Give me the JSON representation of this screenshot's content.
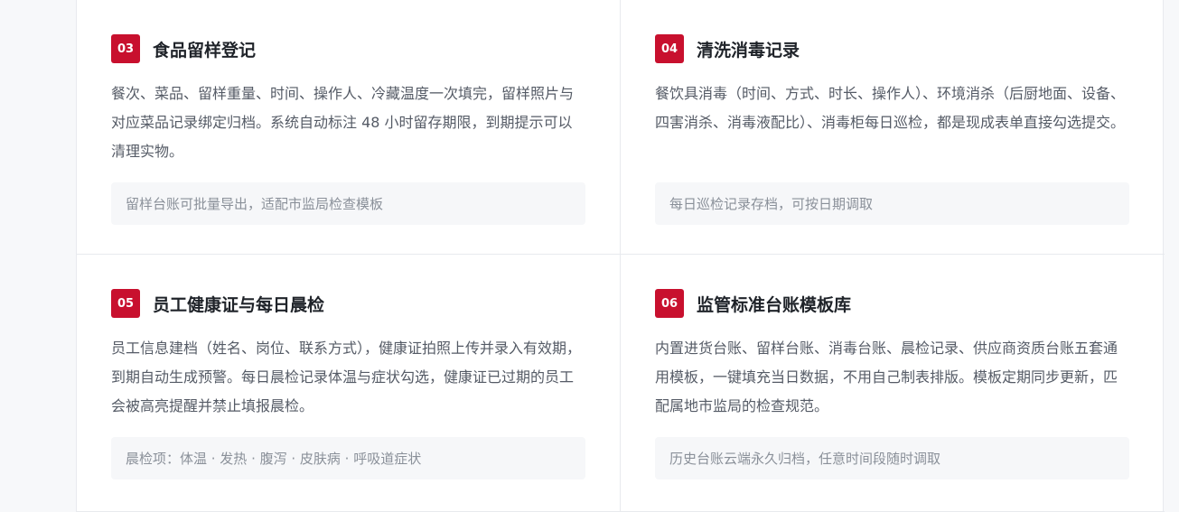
{
  "cards": [
    {
      "number": "03",
      "title": "食品留样登记",
      "description": "餐次、菜品、留样重量、时间、操作人、冷藏温度一次填完，留样照片与对应菜品记录绑定归档。系统自动标注 48 小时留存期限，到期提示可以清理实物。",
      "note": "留样台账可批量导出，适配市监局检查模板"
    },
    {
      "number": "04",
      "title": "清洗消毒记录",
      "description": "餐饮具消毒（时间、方式、时长、操作人）、环境消杀（后厨地面、设备、四害消杀、消毒液配比）、消毒柜每日巡检，都是现成表单直接勾选提交。",
      "note": "每日巡检记录存档，可按日期调取"
    },
    {
      "number": "05",
      "title": "员工健康证与每日晨检",
      "description": "员工信息建档（姓名、岗位、联系方式），健康证拍照上传并录入有效期，到期自动生成预警。每日晨检记录体温与症状勾选，健康证已过期的员工会被高亮提醒并禁止填报晨检。",
      "note": "晨检项：体温 · 发热 · 腹泻 · 皮肤病 · 呼吸道症状"
    },
    {
      "number": "06",
      "title": "监管标准台账模板库",
      "description": "内置进货台账、留样台账、消毒台账、晨检记录、供应商资质台账五套通用模板，一键填充当日数据，不用自己制表排版。模板定期同步更新，匹配属地市监局的检查规范。",
      "note": "历史台账云端永久归档，任意时间段随时调取"
    }
  ],
  "colors": {
    "badge": "#c8102e",
    "title": "#1f2329",
    "text": "#555b66",
    "note_bg": "#f6f7f9"
  }
}
